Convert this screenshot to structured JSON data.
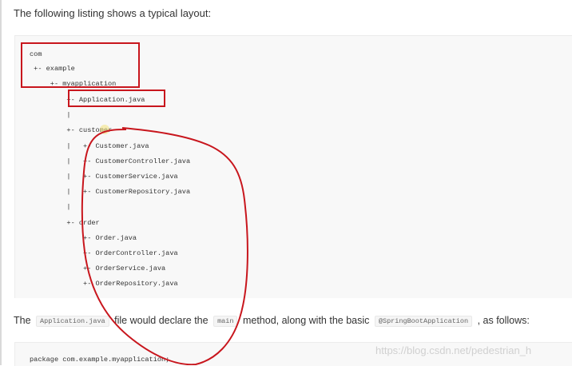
{
  "intro_text": "The following listing shows a typical layout:",
  "tree_lines": [
    "com",
    " +- example",
    "     +- myapplication",
    "         +- Application.java",
    "         |",
    "         +- customer",
    "         |   +- Customer.java",
    "         |   +- CustomerController.java",
    "         |   +- CustomerService.java",
    "         |   +- CustomerRepository.java",
    "         |",
    "         +- order",
    "             +- Order.java",
    "             +- OrderController.java",
    "             +- OrderService.java",
    "             +- OrderRepository.java"
  ],
  "paragraph": {
    "prefix": "The",
    "chip1": "Application.java",
    "mid1": "file would declare the",
    "chip2": "main",
    "mid2": "method, along with the basic",
    "chip3": "@SpringBootApplication",
    "suffix": ", as follows:"
  },
  "package_line": "package com.example.myapplication;",
  "watermark": "https://blog.csdn.net/pedestrian_h",
  "colors": {
    "annotation_red": "#c8161d",
    "highlight_yellow": "#f3e27a"
  }
}
